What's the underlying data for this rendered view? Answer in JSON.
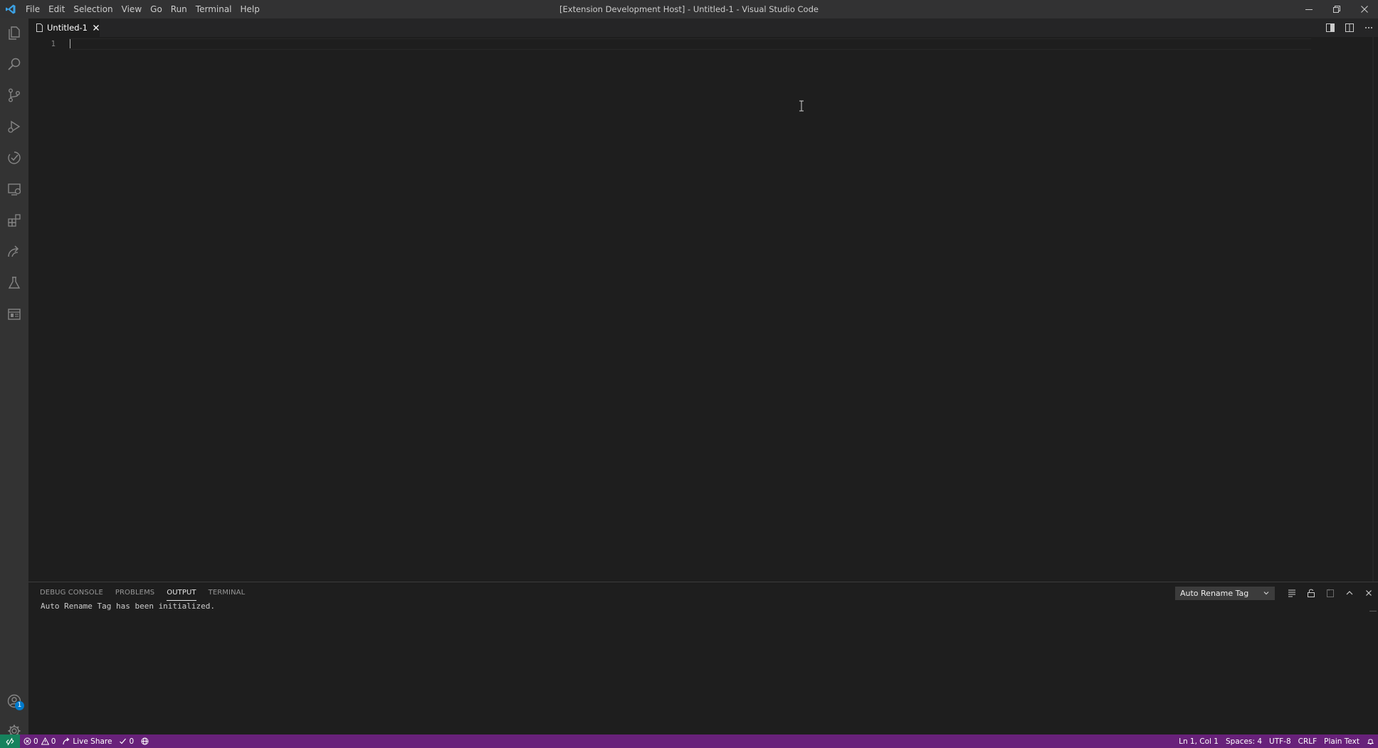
{
  "window": {
    "title": "[Extension Development Host] - Untitled-1 - Visual Studio Code",
    "icon": "vscode-logo"
  },
  "menu": [
    "File",
    "Edit",
    "Selection",
    "View",
    "Go",
    "Run",
    "Terminal",
    "Help"
  ],
  "activity_bar": {
    "items": [
      "explorer-icon",
      "search-icon",
      "source-control-icon",
      "run-debug-icon",
      "testing-check-icon",
      "remote-explorer-icon",
      "extensions-icon",
      "live-share-icon",
      "flask-icon",
      "panel-view-icon"
    ],
    "bottom": [
      "accounts-icon",
      "manage-gear-icon"
    ],
    "accounts_badge": "1"
  },
  "editor": {
    "tab_label": "Untitled-1",
    "line_numbers": [
      "1"
    ]
  },
  "panel": {
    "tabs": [
      "DEBUG CONSOLE",
      "PROBLEMS",
      "OUTPUT",
      "TERMINAL"
    ],
    "active_tab": "OUTPUT",
    "channel": "Auto Rename Tag",
    "output": "Auto Rename Tag has been initialized."
  },
  "status_bar": {
    "errors": "0",
    "warnings": "0",
    "live_share": "Live Share",
    "checks": "0",
    "position": "Ln 1, Col 1",
    "spaces": "Spaces: 4",
    "encoding": "UTF-8",
    "eol": "CRLF",
    "language": "Plain Text"
  },
  "colors": {
    "status_bar": "#68217a",
    "remote_indicator": "#16825d",
    "activity_bar": "#333333",
    "editor_bg": "#1e1e1e",
    "badge": "#007acc"
  }
}
